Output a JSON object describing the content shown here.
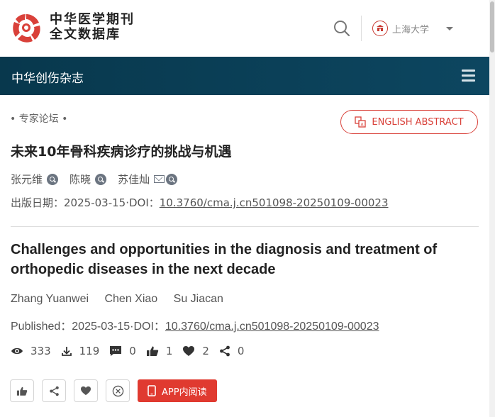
{
  "header": {
    "logo_line1": "中华医学期刊",
    "logo_line2": "全文数据库",
    "institution": "上海大学"
  },
  "nav": {
    "journal": "中华创伤杂志"
  },
  "article": {
    "category": "• 专家论坛 •",
    "english_abstract_label": "ENGLISH ABSTRACT",
    "title_cn": "未来10年骨科疾病诊疗的挑战与机遇",
    "authors_cn": [
      "张元维",
      "陈晓",
      "苏佳灿"
    ],
    "published_label_cn": "出版日期：",
    "date": "2025-03-15",
    "doi_label": "·DOI：",
    "doi": "10.3760/cma.j.cn501098-20250109-00023",
    "title_en": "Challenges and opportunities in the diagnosis and treatment of orthopedic diseases in the next decade",
    "authors_en": [
      "Zhang Yuanwei",
      "Chen Xiao",
      "Su Jiacan"
    ],
    "published_label_en": "Published："
  },
  "stats": {
    "views": "333",
    "downloads": "119",
    "comments": "0",
    "likes": "1",
    "favorites": "2",
    "shares": "0"
  },
  "actions": {
    "app_read_label": "APP内阅读"
  },
  "colors": {
    "accent": "#e03a30",
    "nav_bg": "#0a3f56"
  }
}
